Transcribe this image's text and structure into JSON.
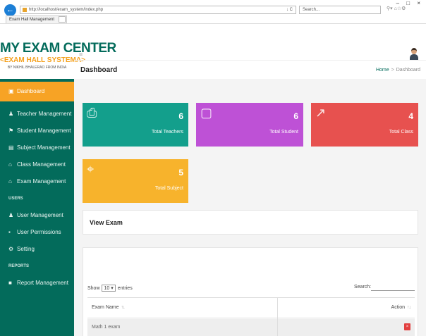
{
  "browser": {
    "address": "http://localhost/exam_system/index.php",
    "refresh_glyph": "↓ C",
    "search_placeholder": "Search...",
    "tab_title": "Exam Hall Management",
    "tab_close": "×",
    "window_controls": "– □ ×"
  },
  "brand": {
    "title": "MY EXAM CENTER",
    "subtitle": "<EXAM HALL SYSTEMA>",
    "byline": "BY NIKHIL BHALERAO FROM INDIA"
  },
  "sidebar": {
    "items": [
      {
        "label": "Dashboard",
        "icon": "dashboard-icon",
        "glyph": "▣"
      },
      {
        "label": "Teacher Management",
        "icon": "user-icon",
        "glyph": "♟"
      },
      {
        "label": "Student Management",
        "icon": "graduation-cap-icon",
        "glyph": "⚑"
      },
      {
        "label": "Subject Management",
        "icon": "book-icon",
        "glyph": "▤"
      },
      {
        "label": "Class Management",
        "icon": "home-icon",
        "glyph": "⌂"
      },
      {
        "label": "Exam Management",
        "icon": "home-icon",
        "glyph": "⌂"
      }
    ],
    "section_users": "USERS",
    "user_items": [
      {
        "label": "User Management",
        "icon": "users-icon",
        "glyph": "♟"
      },
      {
        "label": "User Permissions",
        "icon": "lock-icon",
        "glyph": "▪"
      },
      {
        "label": "Setting",
        "icon": "gear-icon",
        "glyph": "⚙"
      }
    ],
    "section_reports": "REPORTS",
    "report_items": [
      {
        "label": "Report Management",
        "icon": "file-icon",
        "glyph": "■"
      }
    ]
  },
  "header": {
    "menu_glyph": "≡",
    "page_title": "Dashboard",
    "breadcrumb_home": "Home",
    "breadcrumb_sep": ">",
    "breadcrumb_current": "Dashboard"
  },
  "cards": [
    {
      "value": "6",
      "label": "Total Teachers",
      "icon": "printer-icon",
      "glyph": "⎙",
      "color": "#139f8c"
    },
    {
      "value": "6",
      "label": "Total Student",
      "icon": "comment-icon",
      "glyph": "▢",
      "color": "#be51d6"
    },
    {
      "value": "4",
      "label": "Total Class",
      "icon": "share-icon",
      "glyph": "↗",
      "color": "#e7514f"
    },
    {
      "value": "5",
      "label": "Total Subject",
      "icon": "location-pin-icon",
      "glyph": "⌖",
      "color": "#f7b32c"
    }
  ],
  "view_exam": {
    "title": "View Exam"
  },
  "table": {
    "show_prefix": "Show",
    "entries_value": "10",
    "show_suffix": "entries",
    "search_label": "Search:",
    "columns": [
      "Exam Name",
      "Action"
    ],
    "sort_glyph": "↑↓",
    "rows": [
      {
        "exam_name": "Math 1 exam"
      }
    ],
    "delete_glyph": "×"
  }
}
